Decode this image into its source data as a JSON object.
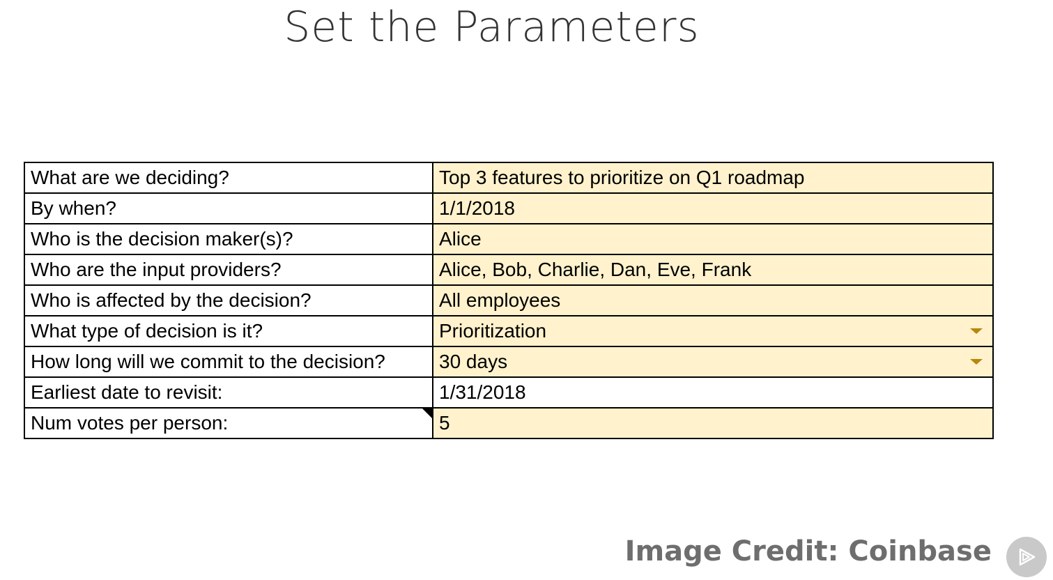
{
  "slide": {
    "title": "Set the Parameters",
    "credit": "Image Credit: Coinbase"
  },
  "parameters": [
    {
      "label": "What are we deciding?",
      "value": "Top 3 features to prioritize on Q1 roadmap",
      "highlighted": true,
      "dropdown": false
    },
    {
      "label": "By when?",
      "value": "1/1/2018",
      "highlighted": true,
      "dropdown": false
    },
    {
      "label": "Who is the decision maker(s)?",
      "value": "Alice",
      "highlighted": true,
      "dropdown": false
    },
    {
      "label": "Who are the input providers?",
      "value": "Alice, Bob, Charlie, Dan, Eve, Frank",
      "highlighted": true,
      "dropdown": false
    },
    {
      "label": "Who is affected by the decision?",
      "value": "All employees",
      "highlighted": true,
      "dropdown": false
    },
    {
      "label": "What type of decision is it?",
      "value": "Prioritization",
      "highlighted": true,
      "dropdown": true
    },
    {
      "label": "How long will we commit to the decision?",
      "value": "30 days",
      "highlighted": true,
      "dropdown": true
    },
    {
      "label": "Earliest date to revisit:",
      "value": "1/31/2018",
      "highlighted": false,
      "dropdown": false
    },
    {
      "label": "Num votes per person:",
      "value": "5",
      "highlighted": true,
      "dropdown": false,
      "comment": true
    }
  ],
  "colors": {
    "highlight_fill": "#fff2cc",
    "dropdown_arrow": "#b7860b",
    "credit_text": "#6e6e6e",
    "play_badge": "#c9c9c9"
  },
  "icons": {
    "dropdown": "caret-down-icon",
    "logo": "play-logo-icon"
  }
}
